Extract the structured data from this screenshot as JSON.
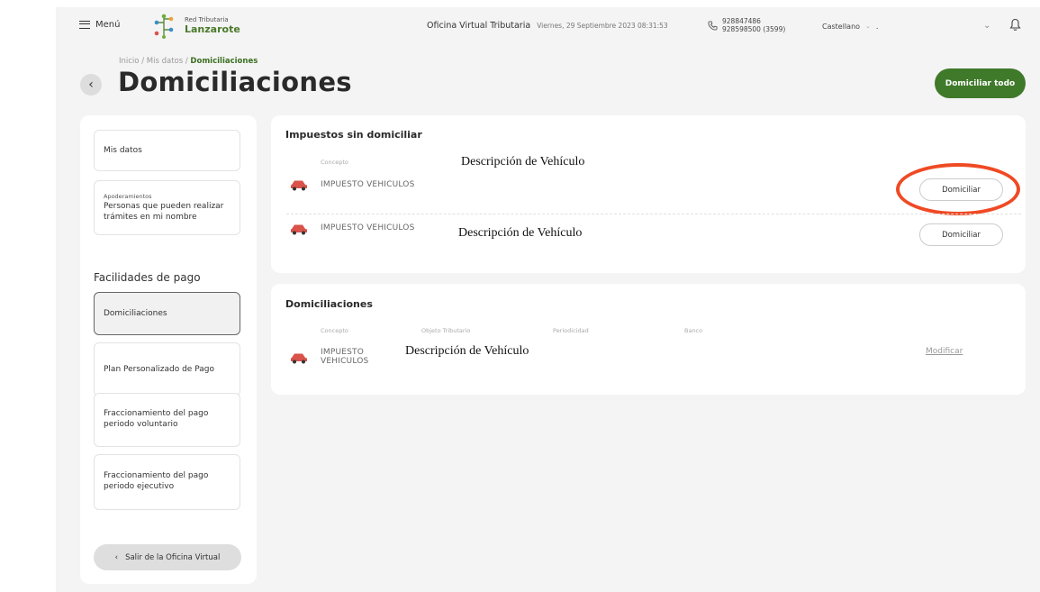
{
  "header": {
    "menu_label": "Menú",
    "logo_small": "Red Tributaria",
    "logo_large": "Lanzarote",
    "office_title": "Oficina Virtual Tributaria",
    "datetime": "Viernes, 29 Septiembre 2023 08:31:53",
    "phone_1": "928847486",
    "phone_2": "928598500 (3599)",
    "language": "Castellano",
    "user_name": "."
  },
  "breadcrumb": {
    "path": "Inicio / Mis datos / ",
    "current": "Domiciliaciones"
  },
  "page": {
    "title": "Domiciliaciones",
    "primary_action": "Domiciliar todo"
  },
  "sidebar": {
    "mis_datos": "Mis datos",
    "apoderamientos_small": "Apoderamientos",
    "apoderamientos_label": "Personas que pueden realizar trámites en mi nombre",
    "section_heading": "Facilidades de pago",
    "items": [
      "Domiciliaciones",
      "Plan Personalizado de Pago",
      "Fraccionamiento del pago periodo voluntario",
      "Fraccionamiento del pago periodo ejecutivo"
    ],
    "exit_label": "Salir de la Oficina Virtual"
  },
  "undomiciled": {
    "title": "Impuestos sin domiciliar",
    "concept_header": "Concepto",
    "rows": [
      {
        "concept": "IMPUESTO VEHICULOS",
        "description": "Descripción de Vehículo",
        "action": "Domiciliar"
      },
      {
        "concept": "IMPUESTO VEHICULOS",
        "description": "Descripción de Vehículo",
        "action": "Domiciliar"
      }
    ]
  },
  "domiciled": {
    "title": "Domiciliaciones",
    "headers": [
      "Concepto",
      "Objeto Tributario",
      "Periodicidad",
      "Banco"
    ],
    "rows": [
      {
        "concept_line1": "IMPUESTO",
        "concept_line2": "VEHICULOS",
        "description": "Descripción de Vehículo",
        "action": "Modificar"
      }
    ]
  },
  "colors": {
    "brand_green": "#3f7a2b",
    "highlight_red": "#ef4a24",
    "car_red": "#d9534a"
  },
  "icons": [
    "hamburger-icon",
    "logo-icon",
    "chevron-left-icon",
    "phone-icon",
    "chevron-down-icon",
    "bell-icon",
    "car-icon"
  ]
}
